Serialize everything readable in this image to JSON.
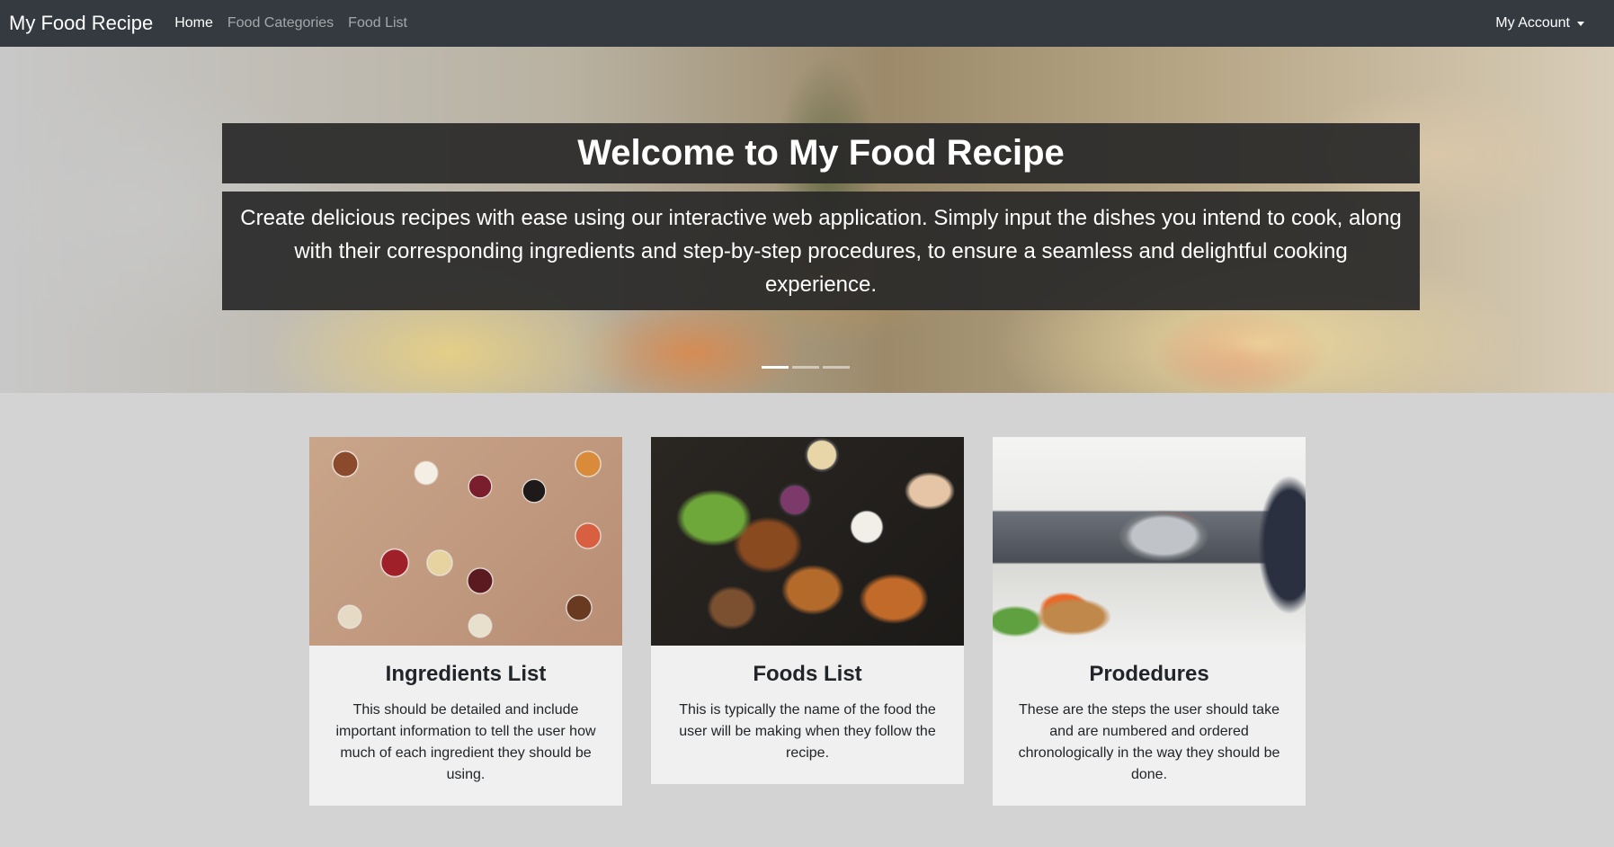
{
  "nav": {
    "brand": "My Food Recipe",
    "links": [
      {
        "label": "Home",
        "active": true
      },
      {
        "label": "Food Categories",
        "active": false
      },
      {
        "label": "Food List",
        "active": false
      }
    ],
    "account_label": "My Account"
  },
  "hero": {
    "title": "Welcome to My Food Recipe",
    "text": "Create delicious recipes with ease using our interactive web application. Simply input the dishes you intend to cook, along with their corresponding ingredients and step-by-step procedures, to ensure a seamless and delightful cooking experience.",
    "slides": 3,
    "active_slide": 0
  },
  "cards": [
    {
      "title": "Ingredients List",
      "text": "This should be detailed and include important information to tell the user how much of each ingredient they should be using.",
      "image": "spices-photo"
    },
    {
      "title": "Foods List",
      "text": "This is typically the name of the food the user will be making when they follow the recipe.",
      "image": "foods-photo"
    },
    {
      "title": "Prodedures",
      "text": "These are the steps the user should take and are numbered and ordered chronologically in the way they should be done.",
      "image": "cooking-photo"
    }
  ],
  "colors": {
    "navbar": "#343a40",
    "page_background": "#d3d3d3",
    "card_background": "#f0f0f0",
    "hero_box": "#282828"
  }
}
